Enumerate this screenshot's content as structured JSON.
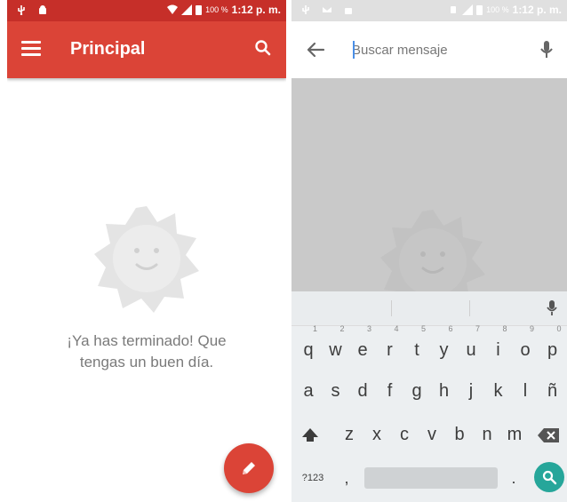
{
  "left": {
    "status": {
      "battery": "100 %",
      "time": "1:12 p. m."
    },
    "appbar": {
      "title": "Principal"
    },
    "empty_state": {
      "line1": "¡Ya has terminado! Que",
      "line2": "tengas un buen día."
    },
    "colors": {
      "appbar": "#db4437",
      "statusbar": "#c62f29"
    }
  },
  "right": {
    "status": {
      "battery": "100 %",
      "time": "1:12 p. m."
    },
    "search": {
      "placeholder": "Buscar mensaje",
      "value": ""
    },
    "keyboard": {
      "row1": [
        "q",
        "w",
        "e",
        "r",
        "t",
        "y",
        "u",
        "i",
        "o",
        "p"
      ],
      "row1_hints": [
        "1",
        "2",
        "3",
        "4",
        "5",
        "6",
        "7",
        "8",
        "9",
        "0"
      ],
      "row2": [
        "a",
        "s",
        "d",
        "f",
        "g",
        "h",
        "j",
        "k",
        "l",
        "ñ"
      ],
      "row3": [
        "z",
        "x",
        "c",
        "v",
        "b",
        "n",
        "m"
      ],
      "symbols_key": "?123",
      "comma_key": ",",
      "period_key": "."
    },
    "colors": {
      "search_key": "#26a69a",
      "cursor": "#4a8fe7"
    }
  }
}
